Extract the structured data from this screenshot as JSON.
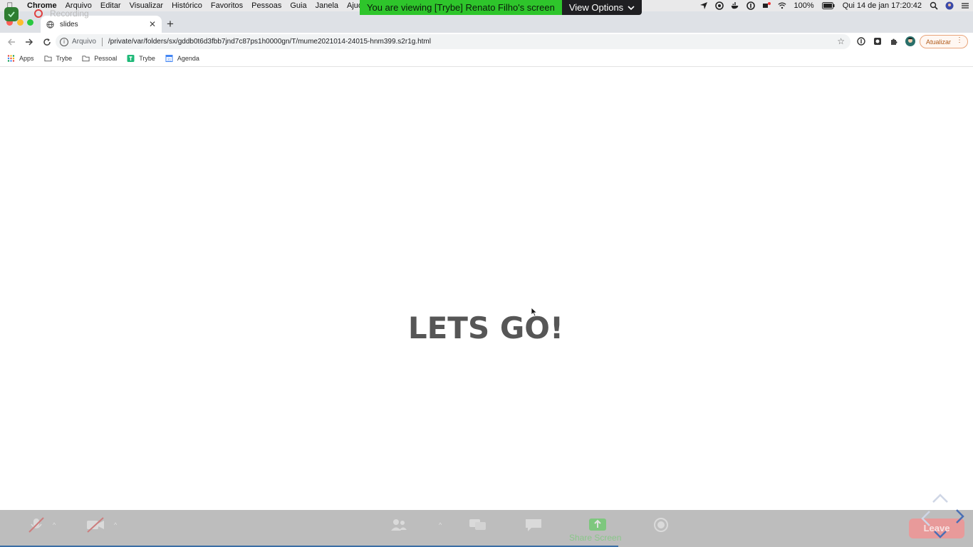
{
  "menubar": {
    "app_name": "Chrome",
    "menus": [
      "Arquivo",
      "Editar",
      "Visualizar",
      "Histórico",
      "Favoritos",
      "Pessoas",
      "Guia",
      "Janela",
      "Ajuda"
    ],
    "battery": "100%",
    "datetime": "Qui 14 de jan  17:20:42"
  },
  "zoom_banner": {
    "viewing_text": "You are viewing [Trybe] Renato Filho's screen",
    "view_options_label": "View Options"
  },
  "recording": {
    "label": "Recording"
  },
  "browser": {
    "tab_title": "slides",
    "address_prefix": "Arquivo",
    "url": "/private/var/folders/sx/gddb0t6d3fbb7jnd7c87ps1h0000gn/T/mume2021014-24015-hnm399.s2r1g.html",
    "update_label": "Atualizar"
  },
  "bookmarks": [
    {
      "label": "Apps",
      "icon": "apps-grid-icon"
    },
    {
      "label": "Trybe",
      "icon": "folder-icon"
    },
    {
      "label": "Pessoal",
      "icon": "folder-icon"
    },
    {
      "label": "Trybe",
      "icon": "trybe-icon"
    },
    {
      "label": "Agenda",
      "icon": "calendar-icon"
    }
  ],
  "slide": {
    "title": "LETS GO!"
  },
  "zoom_controls": {
    "share_label": "Share Screen",
    "leave_label": "Leave"
  },
  "colors": {
    "zoom_green": "#2ec52b",
    "view_options_bg": "#1f1f22",
    "slide_text": "#565656",
    "leave_red": "#e89a9a"
  }
}
